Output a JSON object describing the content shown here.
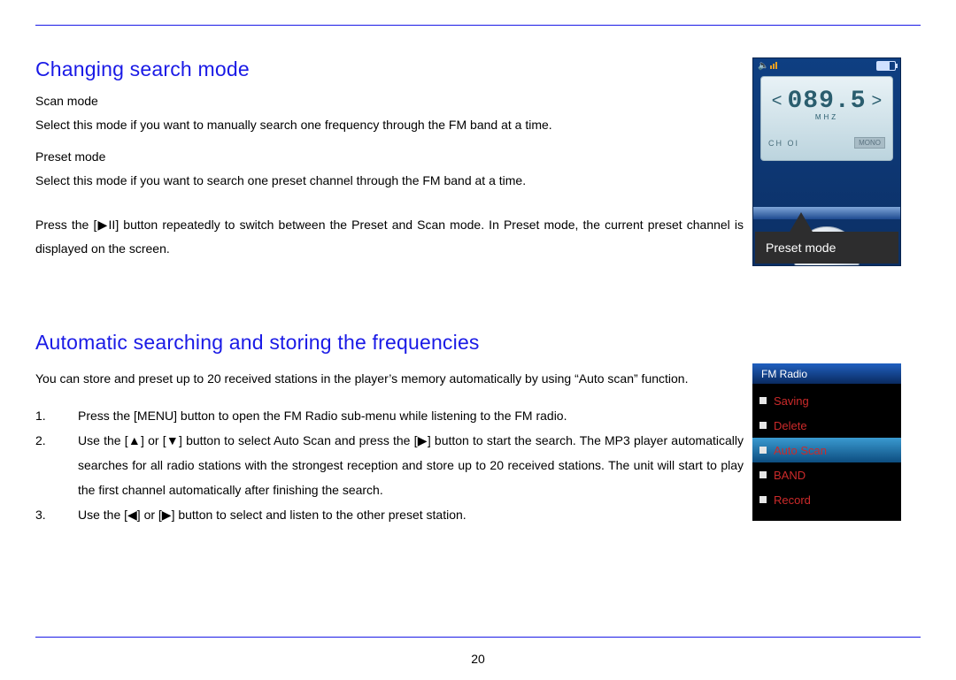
{
  "page_number": "20",
  "section1": {
    "heading": "Changing search mode",
    "scan_label": "Scan mode",
    "scan_desc": "Select this mode if you want to manually search one frequency through the FM band at a time.",
    "preset_label": "Preset mode",
    "preset_desc": "Select this mode if you want to search one preset channel through the FM band at a time.",
    "press_pre": "Press the [",
    "press_glyph": "▶II",
    "press_post": "] button repeatedly to switch between the Preset and Scan mode. In Preset mode, the current preset channel is displayed on the screen."
  },
  "section2": {
    "heading": "Automatic searching and storing the frequencies",
    "intro": "You can store and preset up to 20 received stations in the player’s memory automatically by using “Auto scan” function.",
    "steps": [
      {
        "num": "1.",
        "text": "Press the [MENU] button to open the FM Radio sub-menu while listening to the FM radio."
      },
      {
        "num": "2.",
        "text": "Use the [▲] or [▼] button to select Auto Scan and press the [▶] button to start the search. The MP3 player automatically searches for all radio stations with the strongest reception and store up to 20 received stations. The unit will start to play the first channel automatically after finishing the search."
      },
      {
        "num": "3.",
        "text": "Use the [◀] or [▶] button to select and listen to the other preset station."
      }
    ]
  },
  "device1": {
    "frequency": "089.5",
    "mhz_label": "MHZ",
    "channel": "CH  OI",
    "mono": "MONO",
    "callout": "Preset mode"
  },
  "device2": {
    "title": "FM Radio",
    "items": [
      {
        "label": "Saving",
        "selected": false
      },
      {
        "label": "Delete",
        "selected": false
      },
      {
        "label": "Auto Scan",
        "selected": true
      },
      {
        "label": "BAND",
        "selected": false
      },
      {
        "label": "Record",
        "selected": false
      }
    ]
  }
}
